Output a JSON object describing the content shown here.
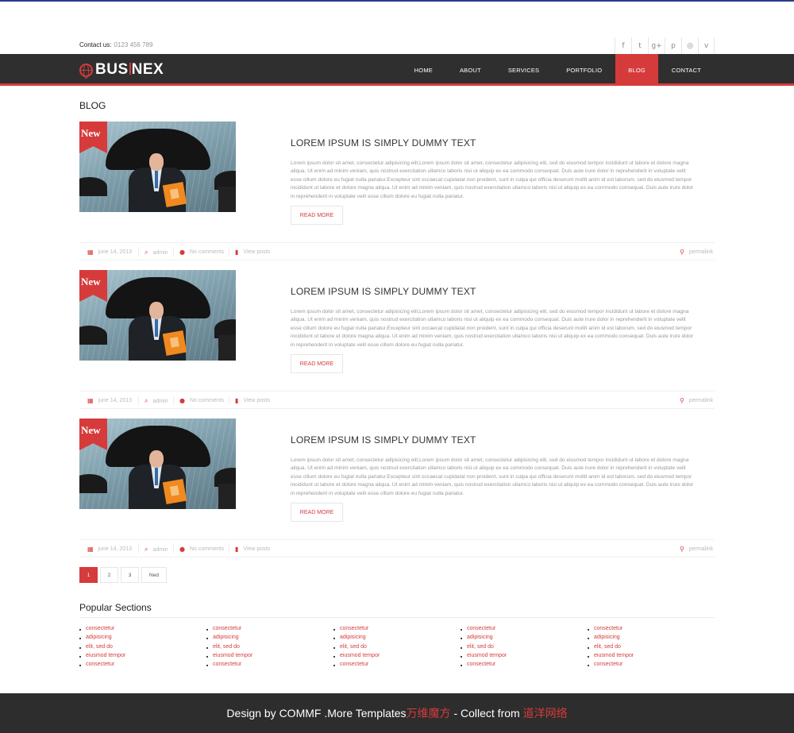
{
  "topbar": {
    "contact_label": "Contact us:",
    "contact_number": "0123 456 789",
    "social": [
      {
        "name": "facebook-icon",
        "glyph": "f"
      },
      {
        "name": "twitter-icon",
        "glyph": "t"
      },
      {
        "name": "google-plus-icon",
        "glyph": "g+"
      },
      {
        "name": "pinterest-icon",
        "glyph": "p"
      },
      {
        "name": "dribbble-icon",
        "glyph": "◎"
      },
      {
        "name": "vimeo-icon",
        "glyph": "v"
      }
    ]
  },
  "nav": {
    "logo": "BUSINEX",
    "items": [
      "HOME",
      "ABOUT",
      "SERVICES",
      "PORTFOLIO",
      "BLOG",
      "CONTACT"
    ],
    "active": "BLOG"
  },
  "blog": {
    "title": "BLOG",
    "posts": [
      {
        "badge": "New",
        "title": "LOREM IPSUM IS SIMPLY DUMMY TEXT",
        "text": "Lorem ipsum dolor sit amet, consectetur adipisicing elit,Lorem ipsum dolor sit amet, consectetur adipisicing elit, sed do eiusmod tempor incididunt ut labore et dolore magna aliqua. Ut enim ad minim veniam, quis nostrud exercitation ullamco laboris nisi ut aliquip ex ea commodo consequat. Duis aute irure dolor in reprehenderit in voluptate velit esse cillum dolore eu fugiat nulla pariatur.Excepteur sint occaecat cupidatat non proident, sunt in culpa qui officia deserunt mollit anim id est laborum. sed do eiusmod tempor incididunt ut labore et dolore magna aliqua. Ut enim ad minim veniam, quis nostrud exercitation ullamco laboris nisi ut aliquip ex ea commodo consequat. Duis aute irure dolor in reprehenderit in voluptate velit esse cillum dolore eu fugiat nulla pariatur.",
        "read_more": "READ MORE",
        "date": "june 14, 2013",
        "author": "admin",
        "comments": "No comments",
        "view": "View posts",
        "permalink": "permalink"
      },
      {
        "badge": "New",
        "title": "LOREM IPSUM IS SIMPLY DUMMY TEXT",
        "text": "Lorem ipsum dolor sit amet, consectetur adipisicing elit,Lorem ipsum dolor sit amet, consectetur adipisicing elit, sed do eiusmod tempor incididunt ut labore et dolore magna aliqua. Ut enim ad minim veniam, quis nostrud exercitation ullamco laboris nisi ut aliquip ex ea commodo consequat. Duis aute irure dolor in reprehenderit in voluptate velit esse cillum dolore eu fugiat nulla pariatur.Excepteur sint occaecat cupidatat non proident, sunt in culpa qui officia deserunt mollit anim id est laborum. sed do eiusmod tempor incididunt ut labore et dolore magna aliqua. Ut enim ad minim veniam, quis nostrud exercitation ullamco laboris nisi ut aliquip ex ea commodo consequat. Duis aute irure dolor in reprehenderit in voluptate velit esse cillum dolore eu fugiat nulla pariatur.",
        "read_more": "READ MORE",
        "date": "june 14, 2013",
        "author": "admin",
        "comments": "No comments",
        "view": "View posts",
        "permalink": "permalink"
      },
      {
        "badge": "New",
        "title": "LOREM IPSUM IS SIMPLY DUMMY TEXT",
        "text": "Lorem ipsum dolor sit amet, consectetur adipisicing elit,Lorem ipsum dolor sit amet, consectetur adipisicing elit, sed do eiusmod tempor incididunt ut labore et dolore magna aliqua. Ut enim ad minim veniam, quis nostrud exercitation ullamco laboris nisi ut aliquip ex ea commodo consequat. Duis aute irure dolor in reprehenderit in voluptate velit esse cillum dolore eu fugiat nulla pariatur.Excepteur sint occaecat cupidatat non proident, sunt in culpa qui officia deserunt mollit anim id est laborum. sed do eiusmod tempor incididunt ut labore et dolore magna aliqua. Ut enim ad minim veniam, quis nostrud exercitation ullamco laboris nisi ut aliquip ex ea commodo consequat. Duis aute irure dolor in reprehenderit in voluptate velit esse cillum dolore eu fugiat nulla pariatur.",
        "read_more": "READ MORE",
        "date": "june 14, 2013",
        "author": "admin",
        "comments": "No comments",
        "view": "View posts",
        "permalink": "permalink"
      }
    ]
  },
  "pagination": {
    "pages": [
      "1",
      "2",
      "3"
    ],
    "active": "1",
    "next": "Ned"
  },
  "popular": {
    "title": "Popular Sections",
    "columns": [
      [
        "consectetur",
        "adipisicing",
        "elit, sed do",
        "eiusmod tempor",
        "consectetur"
      ],
      [
        "consectetur",
        "adipisicing",
        "elit, sed do",
        "eiusmod tempor",
        "consectetur"
      ],
      [
        "consectetur",
        "adipisicing",
        "elit, sed do",
        "eiusmod tempor",
        "consectetur"
      ],
      [
        "consectetur",
        "adipisicing",
        "elit, sed do",
        "eiusmod tempor",
        "consectetur"
      ],
      [
        "consectetur",
        "adipisicing",
        "elit, sed do",
        "eiusmod tempor",
        "consectetur"
      ]
    ]
  },
  "footer": {
    "part1": "Design by COMMF .More Templates ",
    "link1": "万维魔方",
    "part2": " - Collect from ",
    "link2": "道洋网络"
  },
  "colors": {
    "accent": "#d63b3b",
    "nav_bg": "#2f2f2f",
    "footer_bg": "#2d2d2d"
  }
}
